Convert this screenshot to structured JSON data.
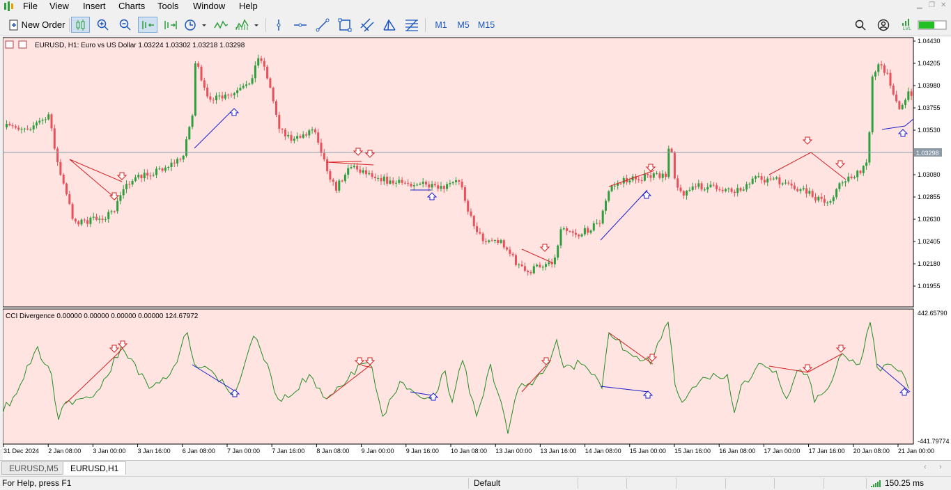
{
  "menu": [
    "File",
    "View",
    "Insert",
    "Charts",
    "Tools",
    "Window",
    "Help"
  ],
  "toolbar": {
    "new_order": "New Order",
    "timeframes": [
      "M1",
      "M5",
      "M15"
    ],
    "level_label": "LVL"
  },
  "chart": {
    "header": "EURUSD, H1:  Euro vs US Dollar  1.03224 1.03302 1.03218 1.03298",
    "current_price_label": "1.03298",
    "price_ticks": [
      "1.04430",
      "1.04205",
      "1.03980",
      "1.03755",
      "1.03530",
      "1.03080",
      "1.02855",
      "1.02630",
      "1.02405",
      "1.02180",
      "1.01955"
    ],
    "indicator_header": "CCI Divergence 0.00000 0.00000 0.00000 0.00000 124.67972",
    "indicator_max": "442.65790",
    "indicator_min": "-441.79774",
    "time_ticks": [
      "31 Dec 2024",
      "2 Jan 08:00",
      "3 Jan 00:00",
      "3 Jan 16:00",
      "6 Jan 08:00",
      "7 Jan 00:00",
      "7 Jan 16:00",
      "8 Jan 08:00",
      "9 Jan 00:00",
      "9 Jan 16:00",
      "10 Jan 08:00",
      "13 Jan 00:00",
      "13 Jan 16:00",
      "14 Jan 08:00",
      "15 Jan 00:00",
      "15 Jan 16:00",
      "16 Jan 08:00",
      "17 Jan 00:00",
      "17 Jan 16:00",
      "20 Jan 08:00",
      "21 Jan 00:00"
    ],
    "colors": {
      "background": "#ffe4e1",
      "bull": "#2e9e3e",
      "bear": "#e8505a",
      "cci": "#228b22",
      "bear_div": "#d42020",
      "bull_div": "#1a1acc",
      "price_line": "#8c9aa8"
    }
  },
  "tabs": [
    "EURUSD,M5",
    "EURUSD,H1"
  ],
  "status": {
    "help": "For Help, press F1",
    "profile": "Default",
    "ping": "150.25 ms"
  }
}
